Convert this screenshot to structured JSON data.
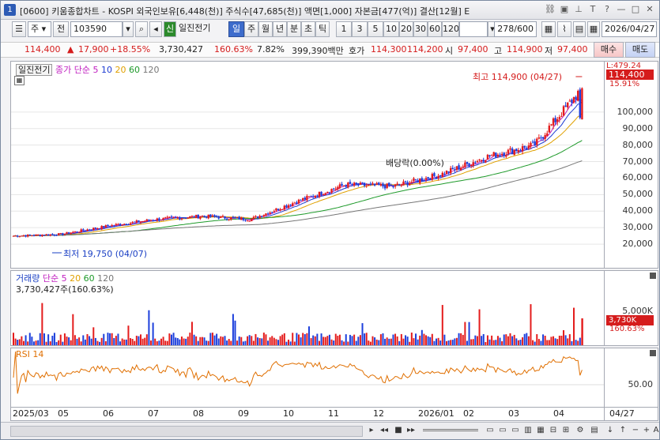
{
  "window": {
    "number": "1",
    "title": "[0600] 키움종합차트 - KOSPI 외국인보유[6,448(천)] 주식수[47,685(천)] 액면[1,000] 자본금[477(억)] 결산[12월] E"
  },
  "toolbar": {
    "market": "주",
    "prev_label": "전",
    "code": "103590",
    "tag_new": "신",
    "stock_name": "일진전기",
    "period_tabs": [
      "일",
      "주",
      "월",
      "년",
      "분",
      "초",
      "틱"
    ],
    "active_period": "일",
    "intervals": [
      "1",
      "3",
      "5",
      "10",
      "20",
      "30",
      "60",
      "120"
    ],
    "count": "278",
    "count_total": "/600",
    "date": "2026/04/27",
    "buy_label": "매수",
    "sell_label": "매도"
  },
  "quote": {
    "price": "114,400",
    "change": "17,900",
    "change_pct": "+18.55%",
    "volume": "3,730,427",
    "volume_ratio": "160.63%",
    "turnover": "7.82%",
    "amount": "399,390백만",
    "ask_label": "호가",
    "ask": "114,300",
    "bid": "114,200",
    "open_label": "시",
    "open": "97,400",
    "high_label": "고",
    "high": "114,900",
    "low_label": "저",
    "low": "97,400"
  },
  "price_pane": {
    "legend_name": "일진전기",
    "legend_price": "종가",
    "legend_ma_type": "단순",
    "ma_periods": [
      "5",
      "10",
      "20",
      "60",
      "120"
    ],
    "ma_colors": [
      "#c01fc0",
      "#1d3bd2",
      "#e0a000",
      "#1e9a2a",
      "#777777"
    ],
    "y_ticks": [
      "100,000",
      "90,000",
      "80,000",
      "70,000",
      "60,000",
      "50,000",
      "40,000",
      "30,000",
      "20,000"
    ],
    "last_price": "114,400",
    "last_pct": "15.91%",
    "top_label": "L:479.24",
    "high_note": "최고 114,900 (04/27)",
    "low_note": "최저 19,750 (04/07)",
    "dividend_note": "배당락(0.00%)"
  },
  "volume_pane": {
    "legend_name": "거래량",
    "legend_ma_type": "단순",
    "ma_periods": [
      "5",
      "20",
      "60",
      "120"
    ],
    "value": "3,730,427주(160.63%)",
    "y_tick": "5,000K",
    "last": "3,730K",
    "last_pct": "160.63%"
  },
  "rsi_pane": {
    "legend_name": "RSI 14",
    "y_tick": "50.00"
  },
  "x_axis": {
    "labels": [
      "2025/03",
      "05",
      "06",
      "07",
      "08",
      "09",
      "10",
      "11",
      "12",
      "2026/01",
      "02",
      "03",
      "04"
    ],
    "right_label": "04/27"
  },
  "chart_data": {
    "type": "candlestick",
    "title": "일진전기",
    "ylim": [
      10000,
      120000
    ],
    "highest": {
      "value": 114900,
      "date": "04/27"
    },
    "lowest": {
      "value": 19750,
      "date": "04/07"
    },
    "monthly_close": [
      {
        "month": "2025/03",
        "close": 25000
      },
      {
        "month": "2025/05",
        "close": 26000
      },
      {
        "month": "2025/06",
        "close": 31000
      },
      {
        "month": "2025/07",
        "close": 35000
      },
      {
        "month": "2025/08",
        "close": 37000
      },
      {
        "month": "2025/09",
        "close": 35000
      },
      {
        "month": "2025/10",
        "close": 46000
      },
      {
        "month": "2025/11",
        "close": 56000
      },
      {
        "month": "2025/12",
        "close": 55000
      },
      {
        "month": "2026/01",
        "close": 62000
      },
      {
        "month": "2026/02",
        "close": 73000
      },
      {
        "month": "2026/03",
        "close": 80000
      },
      {
        "month": "2026/04",
        "close": 114400
      }
    ]
  }
}
